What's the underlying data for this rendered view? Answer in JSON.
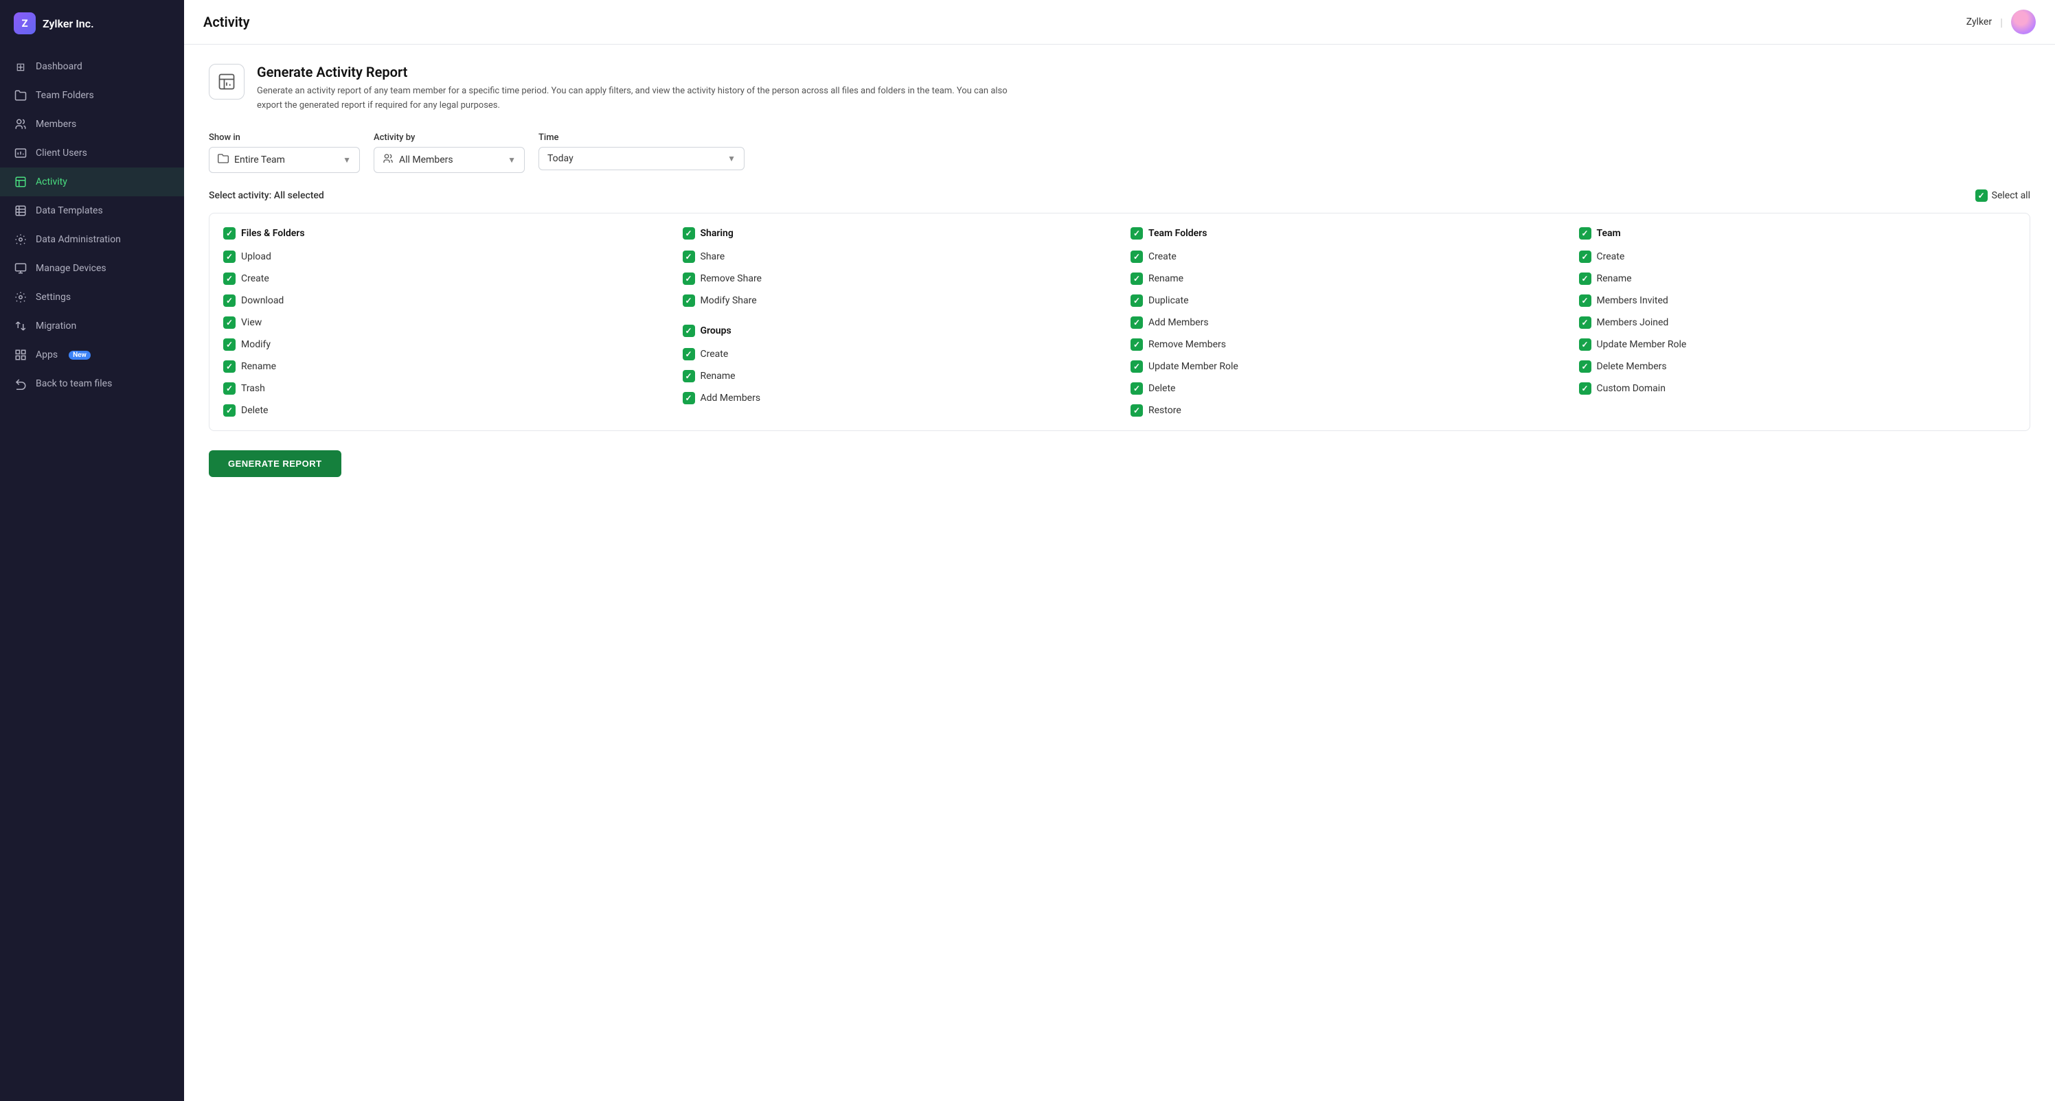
{
  "app": {
    "company": "Zylker Inc.",
    "logo_letter": "Z"
  },
  "sidebar": {
    "items": [
      {
        "id": "dashboard",
        "label": "Dashboard",
        "icon": "⊞",
        "active": false
      },
      {
        "id": "team-folders",
        "label": "Team Folders",
        "icon": "🗂",
        "active": false
      },
      {
        "id": "members",
        "label": "Members",
        "icon": "👥",
        "active": false
      },
      {
        "id": "client-users",
        "label": "Client Users",
        "icon": "🪪",
        "active": false
      },
      {
        "id": "activity",
        "label": "Activity",
        "icon": "📊",
        "active": true
      },
      {
        "id": "data-templates",
        "label": "Data Templates",
        "icon": "📋",
        "active": false
      },
      {
        "id": "data-administration",
        "label": "Data Administration",
        "icon": "⚙",
        "active": false
      },
      {
        "id": "manage-devices",
        "label": "Manage Devices",
        "icon": "🖥",
        "active": false
      },
      {
        "id": "settings",
        "label": "Settings",
        "icon": "⚙",
        "active": false
      },
      {
        "id": "migration",
        "label": "Migration",
        "icon": "↕",
        "active": false
      },
      {
        "id": "apps",
        "label": "Apps",
        "icon": "⊞",
        "active": false,
        "badge": "New"
      },
      {
        "id": "back-to-team-files",
        "label": "Back to team files",
        "icon": "↩",
        "active": false
      }
    ]
  },
  "topbar": {
    "title": "Activity",
    "user": "Zylker"
  },
  "report": {
    "title": "Generate Activity Report",
    "description": "Generate an activity report of any team member for a specific time period. You can apply filters, and view the activity history of the person across all files and folders in the team. You can also export the generated report if required for any legal purposes.",
    "icon": "📊"
  },
  "filters": {
    "show_in_label": "Show in",
    "show_in_value": "Entire Team",
    "activity_by_label": "Activity by",
    "activity_by_value": "All Members",
    "time_label": "Time",
    "time_value": "Today"
  },
  "select_activity": {
    "label": "Select activity: All selected",
    "select_all": "Select all"
  },
  "categories": [
    {
      "id": "files-folders",
      "label": "Files & Folders",
      "items": [
        "Upload",
        "Create",
        "Download",
        "View",
        "Modify",
        "Rename",
        "Trash",
        "Delete"
      ]
    },
    {
      "id": "sharing",
      "label": "Sharing",
      "items": [
        "Share",
        "Remove Share",
        "Modify Share"
      ],
      "subcategory": {
        "label": "Groups",
        "items": [
          "Create",
          "Rename",
          "Add Members"
        ]
      }
    },
    {
      "id": "team-folders",
      "label": "Team Folders",
      "items": [
        "Create",
        "Rename",
        "Duplicate",
        "Add Members",
        "Remove Members",
        "Update Member Role",
        "Delete",
        "Restore"
      ]
    },
    {
      "id": "team",
      "label": "Team",
      "items": [
        "Create",
        "Rename",
        "Members Invited",
        "Members Joined",
        "Update Member Role",
        "Delete Members",
        "Custom Domain"
      ]
    }
  ],
  "generate_button": "GENERATE REPORT"
}
